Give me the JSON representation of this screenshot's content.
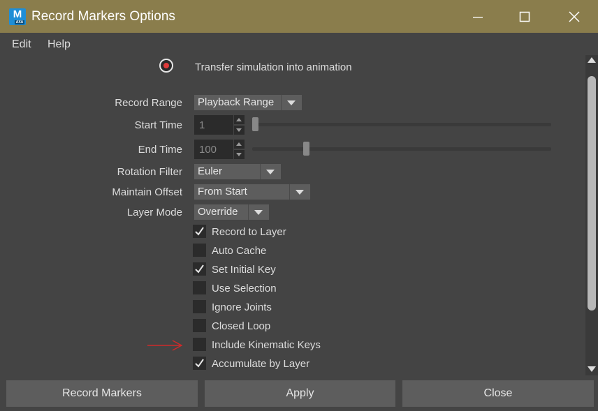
{
  "window": {
    "app_icon_letter": "M",
    "app_icon_sub": "AXA",
    "title": "Record Markers Options"
  },
  "menu": [
    "Edit",
    "Help"
  ],
  "transfer": {
    "label": "Transfer simulation into animation",
    "selected": true
  },
  "fields": {
    "record_range": {
      "label": "Record Range",
      "value": "Playback Range"
    },
    "start_time": {
      "label": "Start Time",
      "value": "1",
      "slider_fraction": 0.0
    },
    "end_time": {
      "label": "End Time",
      "value": "100",
      "slider_fraction": 0.17
    },
    "rotation_filter": {
      "label": "Rotation Filter",
      "value": "Euler"
    },
    "maintain_offset": {
      "label": "Maintain Offset",
      "value": "From Start"
    },
    "layer_mode": {
      "label": "Layer Mode",
      "value": "Override"
    }
  },
  "checkboxes": [
    {
      "label": "Record to Layer",
      "checked": true
    },
    {
      "label": "Auto Cache",
      "checked": false
    },
    {
      "label": "Set Initial Key",
      "checked": true
    },
    {
      "label": "Use Selection",
      "checked": false
    },
    {
      "label": "Ignore Joints",
      "checked": false
    },
    {
      "label": "Closed Loop",
      "checked": false
    },
    {
      "label": "Include Kinematic Keys",
      "checked": false
    },
    {
      "label": "Accumulate by Layer",
      "checked": true
    }
  ],
  "buttons": {
    "record": "Record Markers",
    "apply": "Apply",
    "close": "Close"
  },
  "colors": {
    "titlebar": "#8a7d4c",
    "panel": "#444444",
    "field": "#2b2b2b",
    "annotation_arrow": "#d02a2a"
  }
}
